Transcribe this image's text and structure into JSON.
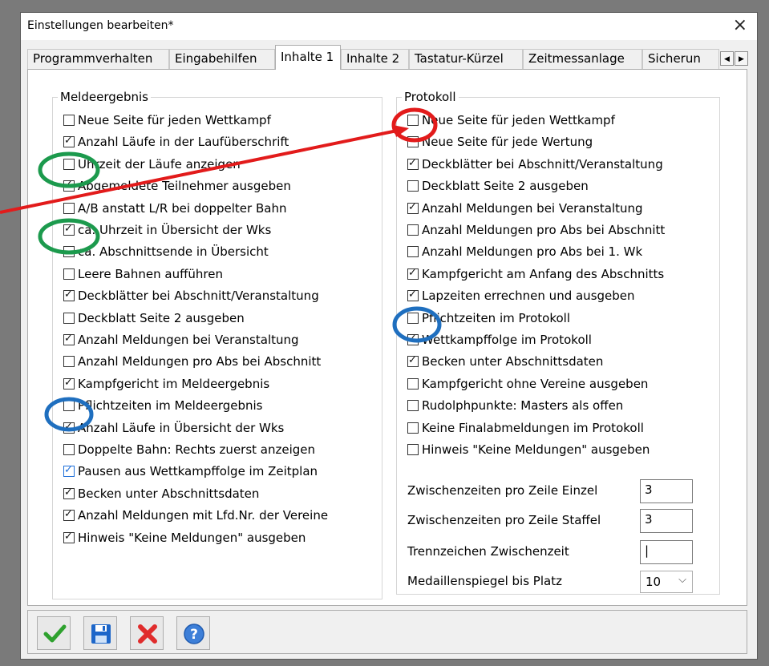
{
  "window": {
    "title": "Einstellungen bearbeiten*",
    "close_glyph": "×"
  },
  "tabs": [
    "Programmverhalten",
    "Eingabehilfen",
    "Inhalte 1",
    "Inhalte 2",
    "Tastatur-Kürzel",
    "Zeitmessanlage",
    "Sicherun"
  ],
  "active_tab": "Inhalte 1",
  "tab_scroll": {
    "left": "◀",
    "right": "▶"
  },
  "meldeergebnis": {
    "legend": "Meldeergebnis",
    "items": [
      {
        "label": "Neue Seite für jeden Wettkampf",
        "checked": false
      },
      {
        "label": "Anzahl Läufe in der Laufüberschrift",
        "checked": true
      },
      {
        "label": "Uhrzeit der Läufe anzeigen",
        "checked": false
      },
      {
        "label": "Abgemeldete Teilnehmer ausgeben",
        "checked": true
      },
      {
        "label": "A/B anstatt L/R bei doppelter Bahn",
        "checked": false
      },
      {
        "label": "ca. Uhrzeit in Übersicht der Wks",
        "checked": true
      },
      {
        "label": "ca. Abschnittsende in Übersicht",
        "checked": false
      },
      {
        "label": "Leere Bahnen aufführen",
        "checked": false
      },
      {
        "label": "Deckblätter bei Abschnitt/Veranstaltung",
        "checked": true
      },
      {
        "label": "Deckblatt Seite 2 ausgeben",
        "checked": false
      },
      {
        "label": "Anzahl Meldungen bei Veranstaltung",
        "checked": true
      },
      {
        "label": "Anzahl Meldungen pro Abs bei Abschnitt",
        "checked": false
      },
      {
        "label": "Kampfgericht im Meldeergebnis",
        "checked": true
      },
      {
        "label": "Pflichtzeiten im Meldeergebnis",
        "checked": false
      },
      {
        "label": "Anzahl Läufe in Übersicht der Wks",
        "checked": true
      },
      {
        "label": "Doppelte Bahn: Rechts zuerst anzeigen",
        "checked": false
      },
      {
        "label": "Pausen aus Wettkampffolge im Zeitplan",
        "checked": true,
        "blue": true
      },
      {
        "label": "Becken unter Abschnittsdaten",
        "checked": true
      },
      {
        "label": "Anzahl Meldungen mit Lfd.Nr. der Vereine",
        "checked": true
      },
      {
        "label": "Hinweis \"Keine Meldungen\" ausgeben",
        "checked": true
      }
    ]
  },
  "protokoll": {
    "legend": "Protokoll",
    "items": [
      {
        "label": "Neue Seite für jeden Wettkampf",
        "checked": false
      },
      {
        "label": "Neue Seite für jede Wertung",
        "checked": false
      },
      {
        "label": "Deckblätter bei Abschnitt/Veranstaltung",
        "checked": true
      },
      {
        "label": "Deckblatt Seite 2 ausgeben",
        "checked": false
      },
      {
        "label": "Anzahl Meldungen bei Veranstaltung",
        "checked": true
      },
      {
        "label": "Anzahl Meldungen pro Abs bei Abschnitt",
        "checked": false
      },
      {
        "label": "Anzahl Meldungen pro Abs bei 1. Wk",
        "checked": false
      },
      {
        "label": "Kampfgericht am Anfang des Abschnitts",
        "checked": true
      },
      {
        "label": "Lapzeiten errechnen und ausgeben",
        "checked": true
      },
      {
        "label": "Pflichtzeiten im Protokoll",
        "checked": false
      },
      {
        "label": "Wettkampffolge im Protokoll",
        "checked": true
      },
      {
        "label": "Becken unter Abschnittsdaten",
        "checked": true
      },
      {
        "label": "Kampfgericht ohne Vereine ausgeben",
        "checked": false
      },
      {
        "label": "Rudolphpunkte: Masters als offen",
        "checked": false
      },
      {
        "label": "Keine Finalabmeldungen im Protokoll",
        "checked": false
      },
      {
        "label": "Hinweis \"Keine Meldungen\" ausgeben",
        "checked": false
      }
    ],
    "fields": {
      "zwischen_einzel": {
        "label": "Zwischenzeiten pro Zeile Einzel",
        "value": "3"
      },
      "zwischen_staffel": {
        "label": "Zwischenzeiten pro Zeile Staffel",
        "value": "3"
      },
      "trennzeichen": {
        "label": "Trennzeichen Zwischenzeit",
        "value": "|"
      },
      "medaillenspiegel": {
        "label": "Medaillenspiegel bis Platz",
        "value": "10"
      }
    }
  },
  "buttons": [
    {
      "name": "ok-button",
      "icon": "check-icon"
    },
    {
      "name": "save-button",
      "icon": "floppy-icon"
    },
    {
      "name": "cancel-button",
      "icon": "red-x-icon"
    },
    {
      "name": "help-button",
      "icon": "help-icon"
    }
  ],
  "annotations": {
    "colors": {
      "red": "#e21b1b",
      "green": "#1c9a4d",
      "blue": "#1f6fbf"
    }
  }
}
